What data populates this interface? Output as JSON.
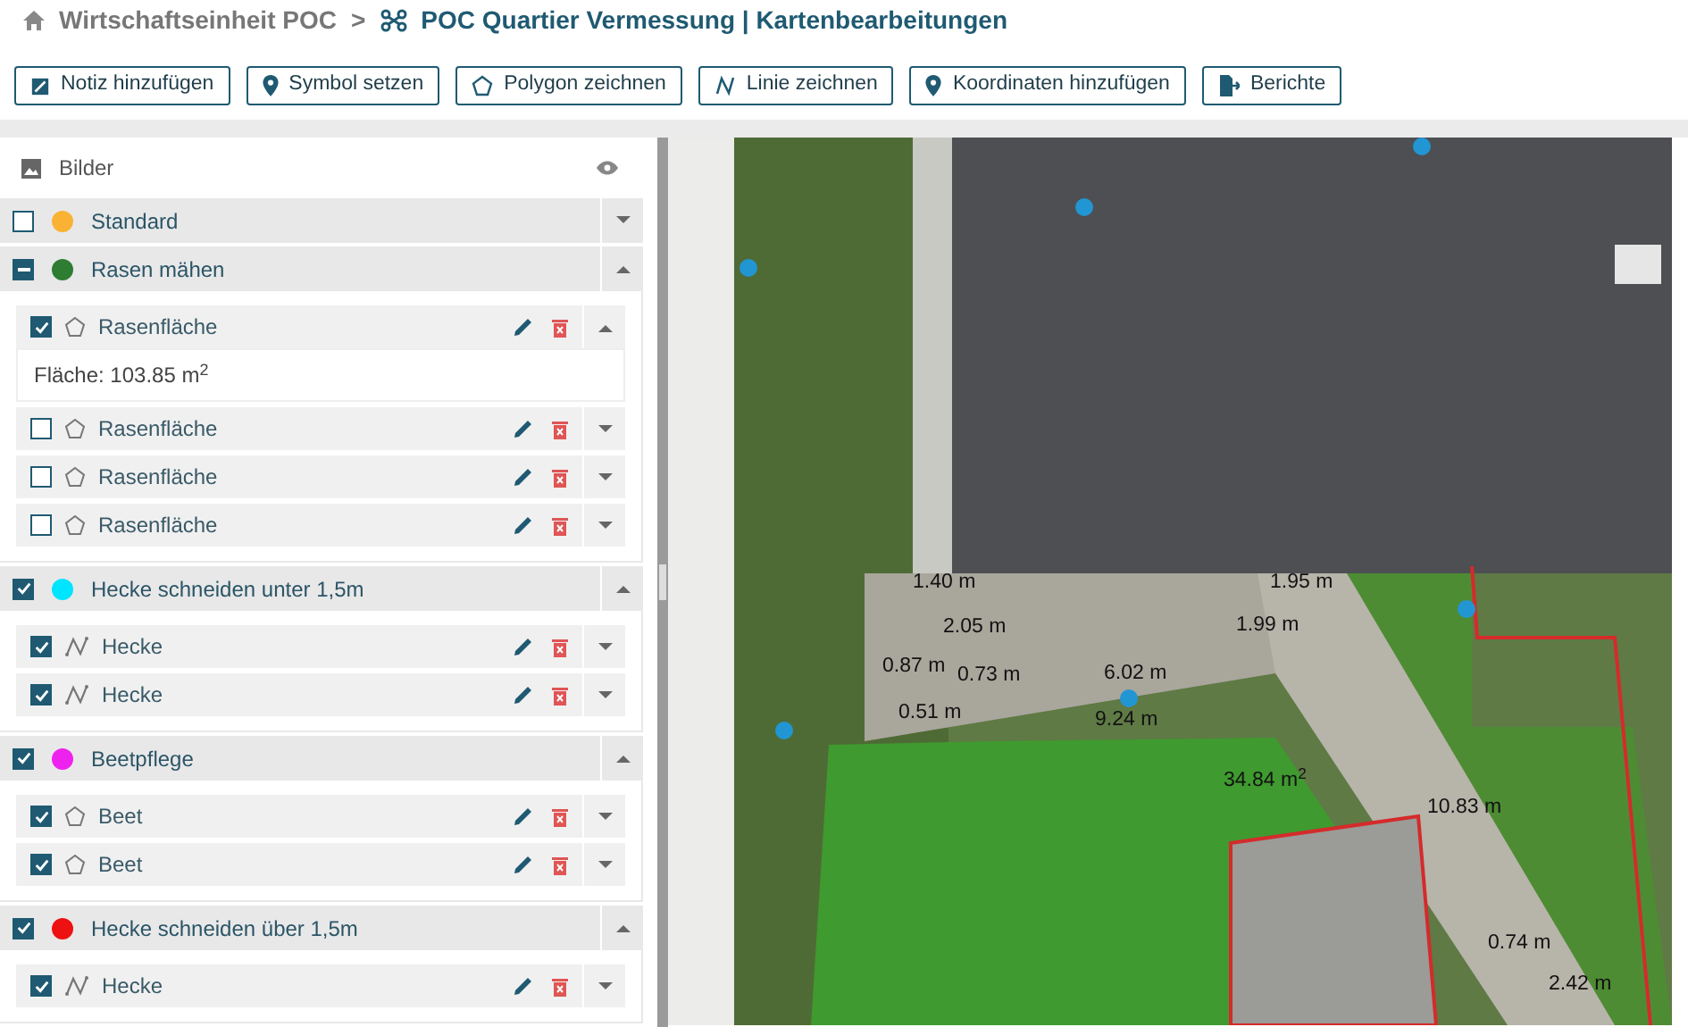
{
  "breadcrumb": {
    "parent": "Wirtschaftseinheit POC",
    "separator": ">",
    "current": "POC Quartier Vermessung | Kartenbearbeitungen"
  },
  "toolbar": [
    {
      "kind": "note",
      "label": "Notiz hinzufügen"
    },
    {
      "kind": "pin",
      "label": "Symbol setzen"
    },
    {
      "kind": "polygon",
      "label": "Polygon zeichnen"
    },
    {
      "kind": "line",
      "label": "Linie zeichnen"
    },
    {
      "kind": "pin",
      "label": "Koordinaten hinzufügen"
    },
    {
      "kind": "report",
      "label": "Berichte"
    }
  ],
  "images_section": {
    "label": "Bilder"
  },
  "layers": [
    {
      "name": "Standard",
      "color": "#f9b233",
      "checked": false,
      "indeterminate": false,
      "expanded": false
    },
    {
      "name": "Rasen mähen",
      "color": "#2e7d32",
      "checked": true,
      "indeterminate": true,
      "expanded": true,
      "items": [
        {
          "kind": "polygon",
          "label": "Rasenfläche",
          "checked": true,
          "expanded": true,
          "detail": "Fläche: 103.85 m$^{2}$"
        },
        {
          "kind": "polygon",
          "label": "Rasenfläche",
          "checked": false,
          "expanded": false
        },
        {
          "kind": "polygon",
          "label": "Rasenfläche",
          "checked": false,
          "expanded": false
        },
        {
          "kind": "polygon",
          "label": "Rasenfläche",
          "checked": false,
          "expanded": false
        }
      ]
    },
    {
      "name": "Hecke schneiden unter 1,5m",
      "color": "#00e5ff",
      "checked": true,
      "indeterminate": false,
      "expanded": true,
      "items": [
        {
          "kind": "line",
          "label": "Hecke",
          "checked": true,
          "expanded": false
        },
        {
          "kind": "line",
          "label": "Hecke",
          "checked": true,
          "expanded": false
        }
      ]
    },
    {
      "name": "Beetpflege",
      "color": "#ee22ee",
      "checked": true,
      "indeterminate": false,
      "expanded": true,
      "items": [
        {
          "kind": "polygon",
          "label": "Beet",
          "checked": true,
          "expanded": false
        },
        {
          "kind": "polygon",
          "label": "Beet",
          "checked": true,
          "expanded": false
        }
      ]
    },
    {
      "name": "Hecke schneiden über 1,5m",
      "color": "#ee1111",
      "checked": true,
      "indeterminate": false,
      "expanded": true,
      "items": [
        {
          "kind": "line",
          "label": "Hecke",
          "checked": true,
          "expanded": false
        }
      ]
    }
  ],
  "map": {
    "measurements": [
      "1.40 m",
      "1.95 m",
      "2.05 m",
      "1.99 m",
      "0.87 m",
      "0.73 m",
      "6.02 m",
      "0.51 m",
      "9.24 m",
      "34.84 m$^{2}$",
      "10.83 m",
      "0.74 m",
      "2.42 m"
    ]
  }
}
